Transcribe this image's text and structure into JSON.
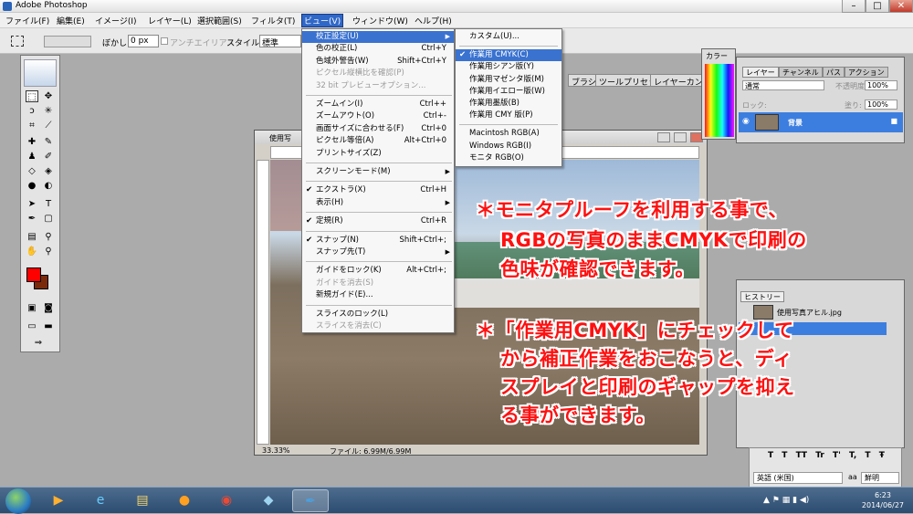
{
  "window": {
    "title": "Adobe Photoshop",
    "controls": [
      "–",
      "□",
      "✕"
    ]
  },
  "menubar": {
    "items": [
      "ファイル(F)",
      "編集(E)",
      "イメージ(I)",
      "レイヤー(L)",
      "選択範囲(S)",
      "フィルタ(T)",
      "ビュー(V)",
      "ウィンドウ(W)",
      "ヘルプ(H)"
    ],
    "active": "ビュー(V)"
  },
  "optionsbar": {
    "feather_label": "ぼかし:",
    "feather_value": "0 px",
    "antialias_label": "アンチエイリアス",
    "style_label": "スタイル:",
    "style_value": "標準"
  },
  "palette_well": {
    "tabs": [
      "ブラシ",
      "ツールプリセット",
      "レイヤーカンプ"
    ]
  },
  "view_menu": {
    "items": [
      {
        "label": "校正設定(U)",
        "shortcut": "",
        "submenu": true,
        "highlighted": true
      },
      {
        "label": "色の校正(L)",
        "shortcut": "Ctrl+Y"
      },
      {
        "label": "色域外警告(W)",
        "shortcut": "Shift+Ctrl+Y"
      },
      {
        "label": "ピクセル縦横比を確認(P)",
        "shortcut": "",
        "disabled": true
      },
      {
        "label": "32 bit プレビューオプション...",
        "shortcut": "",
        "disabled": true
      },
      {
        "sep": true
      },
      {
        "label": "ズームイン(I)",
        "shortcut": "Ctrl++"
      },
      {
        "label": "ズームアウト(O)",
        "shortcut": "Ctrl+-"
      },
      {
        "label": "画面サイズに合わせる(F)",
        "shortcut": "Ctrl+0"
      },
      {
        "label": "ピクセル等倍(A)",
        "shortcut": "Alt+Ctrl+0"
      },
      {
        "label": "プリントサイズ(Z)",
        "shortcut": ""
      },
      {
        "sep": true
      },
      {
        "label": "スクリーンモード(M)",
        "shortcut": "",
        "submenu": true
      },
      {
        "sep": true
      },
      {
        "label": "エクストラ(X)",
        "shortcut": "Ctrl+H",
        "checked": true
      },
      {
        "label": "表示(H)",
        "shortcut": "",
        "submenu": true
      },
      {
        "sep": true
      },
      {
        "label": "定規(R)",
        "shortcut": "Ctrl+R",
        "checked": true
      },
      {
        "sep": true
      },
      {
        "label": "スナップ(N)",
        "shortcut": "Shift+Ctrl+;",
        "checked": true
      },
      {
        "label": "スナップ先(T)",
        "shortcut": "",
        "submenu": true
      },
      {
        "sep": true
      },
      {
        "label": "ガイドをロック(K)",
        "shortcut": "Alt+Ctrl+;"
      },
      {
        "label": "ガイドを消去(S)",
        "shortcut": "",
        "disabled": true
      },
      {
        "label": "新規ガイド(E)...",
        "shortcut": ""
      },
      {
        "sep": true
      },
      {
        "label": "スライスのロック(L)",
        "shortcut": ""
      },
      {
        "label": "スライスを消去(C)",
        "shortcut": "",
        "disabled": true
      }
    ]
  },
  "proof_submenu": {
    "items": [
      {
        "label": "カスタム(U)..."
      },
      {
        "sep": true
      },
      {
        "label": "作業用 CMYK(C)",
        "checked": true,
        "highlighted": true
      },
      {
        "label": "作業用シアン版(Y)"
      },
      {
        "label": "作業用マゼンタ版(M)"
      },
      {
        "label": "作業用イエロー版(W)"
      },
      {
        "label": "作業用墨版(B)"
      },
      {
        "label": "作業用 CMY 版(P)"
      },
      {
        "sep": true
      },
      {
        "label": "Macintosh RGB(A)"
      },
      {
        "label": "Windows RGB(I)"
      },
      {
        "label": "モニタ RGB(O)"
      }
    ]
  },
  "document": {
    "title": "使用写",
    "zoom": "33.33%",
    "file_info": "ファイル: 6.99M/6.99M"
  },
  "layers_panel": {
    "tabs": [
      "レイヤー",
      "チャンネル",
      "パス",
      "アクション"
    ],
    "blend_mode": "通常",
    "opacity_label": "不透明度:",
    "opacity_value": "100%",
    "lock_label": "ロック:",
    "fill_label": "塗り:",
    "fill_value": "100%",
    "layer_name": "背景"
  },
  "swatches_panel": {
    "tab": "カラー"
  },
  "history_panel": {
    "tab": "ヒストリー",
    "snapshot": "使用写真アヒル.jpg"
  },
  "char_panel": {
    "lang": "英語 (米国)",
    "aa_label": "aa",
    "aa_value": "鮮明",
    "styles": [
      "T",
      "T",
      "TT",
      "Tr",
      "T'",
      "T,",
      "T",
      "Ŧ"
    ]
  },
  "annotations": {
    "line1": "＊モニタプルーフを利用する事で、",
    "line2": "RGBの写真のままCMYKで印刷の",
    "line3": "色味が確認できます。",
    "line4": "＊「作業用CMYK」にチェックして",
    "line5": "から補正作業をおこなうと、ディ",
    "line6": "スプレイと印刷のギャップを抑え",
    "line7": "る事ができます。"
  },
  "taskbar": {
    "time": "6:23",
    "date": "2014/06/27"
  }
}
